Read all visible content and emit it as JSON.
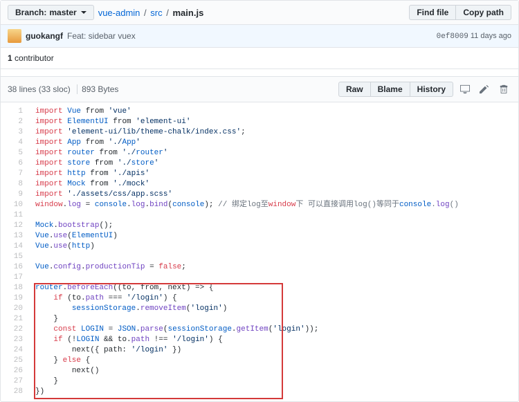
{
  "top": {
    "branch_prefix": "Branch:",
    "branch_name": "master",
    "crumb_root": "vue-admin",
    "crumb_dir": "src",
    "crumb_file": "main.js",
    "find_file": "Find file",
    "copy_path": "Copy path"
  },
  "commit": {
    "author": "guokangf",
    "message": "Feat: sidebar vuex",
    "sha": "0ef8009",
    "age": "11 days ago"
  },
  "contrib": {
    "count": "1",
    "label": "contributor"
  },
  "file": {
    "lines": "38 lines (33 sloc)",
    "bytes": "893 Bytes",
    "raw": "Raw",
    "blame": "Blame",
    "history": "History"
  },
  "code": {
    "line_count": 28,
    "lines": [
      "import Vue from 'vue'",
      "import ElementUI from 'element-ui'",
      "import 'element-ui/lib/theme-chalk/index.css';",
      "import App from './App'",
      "import router from './router'",
      "import store from './store'",
      "import http from './apis'",
      "import Mock from './mock'",
      "import './assets/css/app.scss'",
      "window.log = console.log.bind(console); // 绑定log至window下 可以直接调用log()等同于console.log()",
      "",
      "Mock.bootstrap();",
      "Vue.use(ElementUI)",
      "Vue.use(http)",
      "",
      "Vue.config.productionTip = false;",
      "",
      "router.beforeEach((to, from, next) => {",
      "    if (to.path === '/login') {",
      "        sessionStorage.removeItem('login')",
      "    }",
      "    const LOGIN = JSON.parse(sessionStorage.getItem('login'));",
      "    if (!LOGIN && to.path !== '/login') {",
      "        next({ path: '/login' })",
      "    } else {",
      "        next()",
      "    }",
      "})"
    ]
  }
}
